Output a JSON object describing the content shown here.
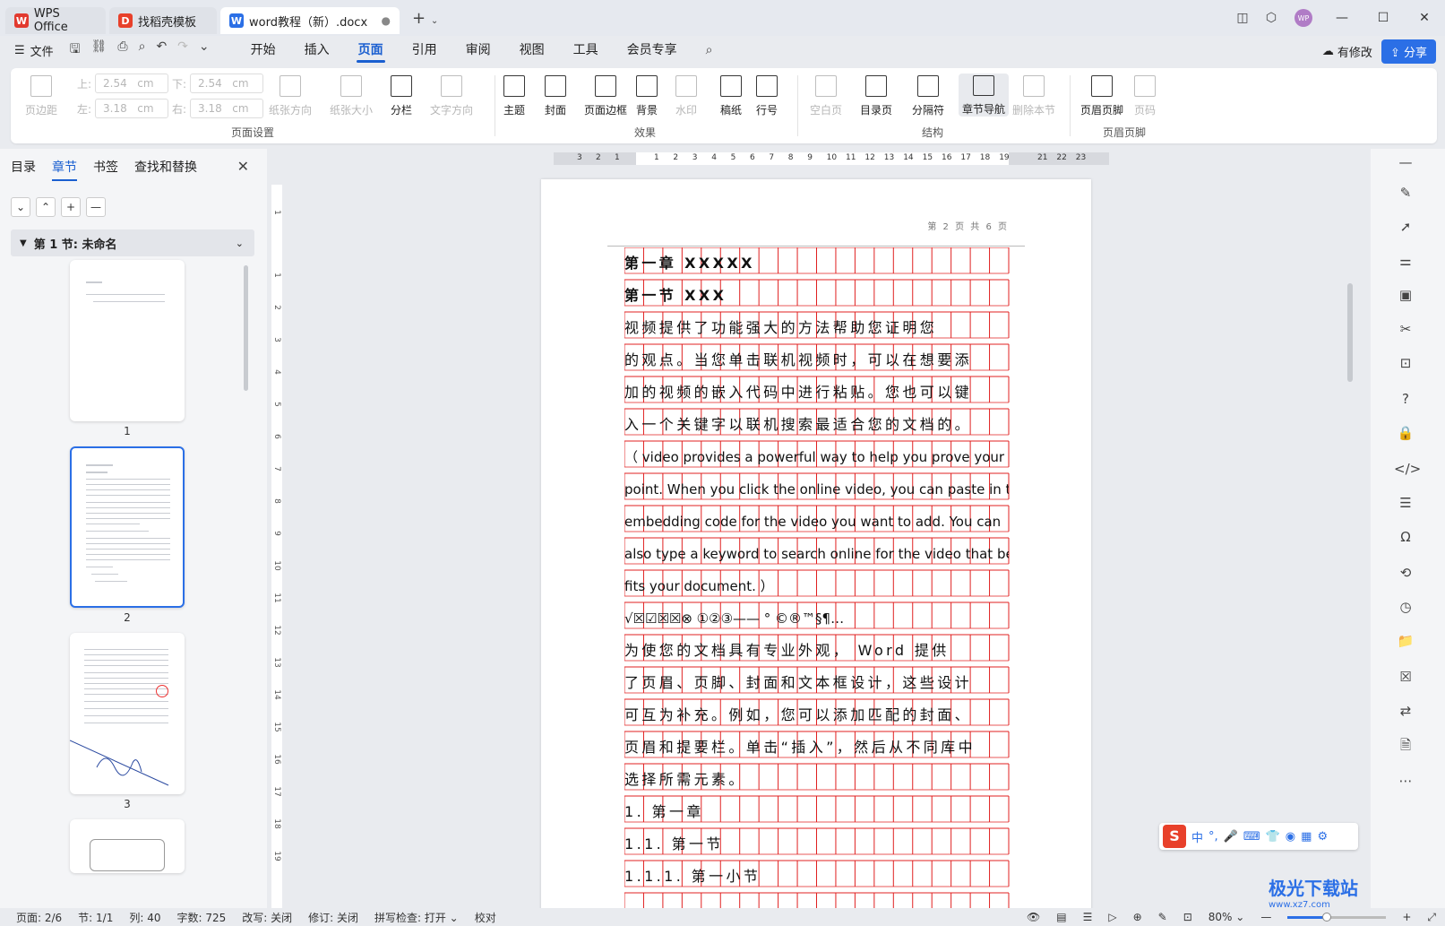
{
  "titlebar": {
    "tabs": [
      {
        "label": "WPS Office",
        "icon": "wps-logo"
      },
      {
        "label": "找稻壳模板",
        "icon": "docer-logo"
      },
      {
        "label": "word教程（新）.docx",
        "icon": "word-doc-logo",
        "active": true
      }
    ],
    "new_tab": "+",
    "avatar": "WP"
  },
  "menubar": {
    "file": "文件",
    "tabs": [
      "开始",
      "插入",
      "页面",
      "引用",
      "审阅",
      "视图",
      "工具",
      "会员专享"
    ],
    "active_tab": "页面",
    "modify": "有修改",
    "share": "分享"
  },
  "ribbon": {
    "page_setup": {
      "margin_label": "页边距",
      "top_label": "上:",
      "top_value": "2.54",
      "bottom_label": "下:",
      "bottom_value": "2.54",
      "left_label": "左:",
      "left_value": "3.18",
      "right_label": "右:",
      "right_value": "3.18",
      "unit": "cm",
      "orientation": "纸张方向",
      "size": "纸张大小",
      "columns": "分栏",
      "text_direction": "文字方向",
      "group": "页面设置"
    },
    "effects": {
      "theme": "主题",
      "cover": "封面",
      "border": "页面边框",
      "background": "背景",
      "watermark": "水印",
      "manuscript": "稿纸",
      "line_numbers": "行号",
      "group": "效果"
    },
    "structure": {
      "blank": "空白页",
      "toc": "目录页",
      "separator": "分隔符",
      "section_nav": "章节导航",
      "delete_section": "删除本节",
      "group": "结构"
    },
    "header_footer": {
      "header_footer": "页眉页脚",
      "page_number": "页码",
      "group": "页眉页脚"
    }
  },
  "leftpanel": {
    "tabs": [
      "目录",
      "章节",
      "书签",
      "查找和替换"
    ],
    "active_tab": "章节",
    "section": "第 1 节: 未命名",
    "thumbnails": [
      "1",
      "2",
      "3"
    ],
    "selected_thumbnail": "2"
  },
  "ruler": {
    "h_left": [
      "3",
      "2",
      "1"
    ],
    "h_right": [
      "1",
      "2",
      "3",
      "4",
      "5",
      "6",
      "7",
      "8",
      "9",
      "10",
      "11",
      "12",
      "13",
      "14",
      "15",
      "16",
      "17",
      "18",
      "19",
      "21",
      "22",
      "23"
    ],
    "v": [
      "1",
      "1",
      "2",
      "3",
      "4",
      "5",
      "6",
      "7",
      "8",
      "9",
      "10",
      "11",
      "12",
      "13",
      "14",
      "15",
      "16",
      "17",
      "18",
      "19"
    ]
  },
  "document": {
    "header": "第 2 页 共 6 页",
    "lines": [
      {
        "text": "第一章 XXXXX",
        "style": "cn bold"
      },
      {
        "text": "第一节 XXX",
        "style": "cn bold"
      },
      {
        "text": "  视频提供了功能强大的方法帮助您证明您",
        "style": "cn"
      },
      {
        "text": "的观点。当您单击联机视频时，可以在想要添",
        "style": "cn"
      },
      {
        "text": "加的视频的嵌入代码中进行粘贴。您也可以键",
        "style": "cn"
      },
      {
        "text": "入一个关键字以联机搜索最适合您的文档的。",
        "style": "cn"
      },
      {
        "text": "（ video provides a powerful way to help you prove your",
        "style": "en"
      },
      {
        "text": " point. When you click the online video, you can paste in the",
        "style": "en"
      },
      {
        "text": "embedding code for the video you want to add. You can",
        "style": "en"
      },
      {
        "text": " also type a keyword to search online for the video that best",
        "style": "en"
      },
      {
        "text": " fits your document. ）",
        "style": "en"
      },
      {
        "text": "√☒☑☒☒⊗  ①②③——  ° ©®™§¶…",
        "style": "en"
      },
      {
        "text": "  为使您的文档具有专业外观， Word 提供",
        "style": "cn"
      },
      {
        "text": "了页眉、页脚、封面和文本框设计，这些设计",
        "style": "cn"
      },
      {
        "text": "可互为补充。例如，您可以添加匹配的封面、",
        "style": "cn"
      },
      {
        "text": "页眉和提要栏。单击“插入”，然后从不同库中",
        "style": "cn"
      },
      {
        "text": "选择所需元素。",
        "style": "cn"
      },
      {
        "text": "1.   第一章",
        "style": "cn"
      },
      {
        "text": "  1.1.   第一节",
        "style": "cn"
      },
      {
        "text": "    1.1.1.  第一小节",
        "style": "cn"
      }
    ],
    "grid_color": "#e02020"
  },
  "ime": {
    "logo": "S",
    "items": [
      "中",
      "°,",
      "mic",
      "keyboard",
      "shirt",
      "game",
      "grid",
      "gear"
    ]
  },
  "statusbar": {
    "page": "页面: 2/6",
    "section": "节: 1/1",
    "column": "列: 40",
    "words": "字数: 725",
    "overtype": "改写: 关闭",
    "revision": "修订: 关闭",
    "spellcheck": "拼写检查: 打开",
    "proofread": "校对",
    "zoom": "80%",
    "zoom_level": 0.4
  },
  "watermark": {
    "brand": "极光下载站",
    "url": "www.xz7.com"
  },
  "colors": {
    "accent": "#1a5fd0",
    "share": "#2b6fe6",
    "grid": "#e02020"
  }
}
